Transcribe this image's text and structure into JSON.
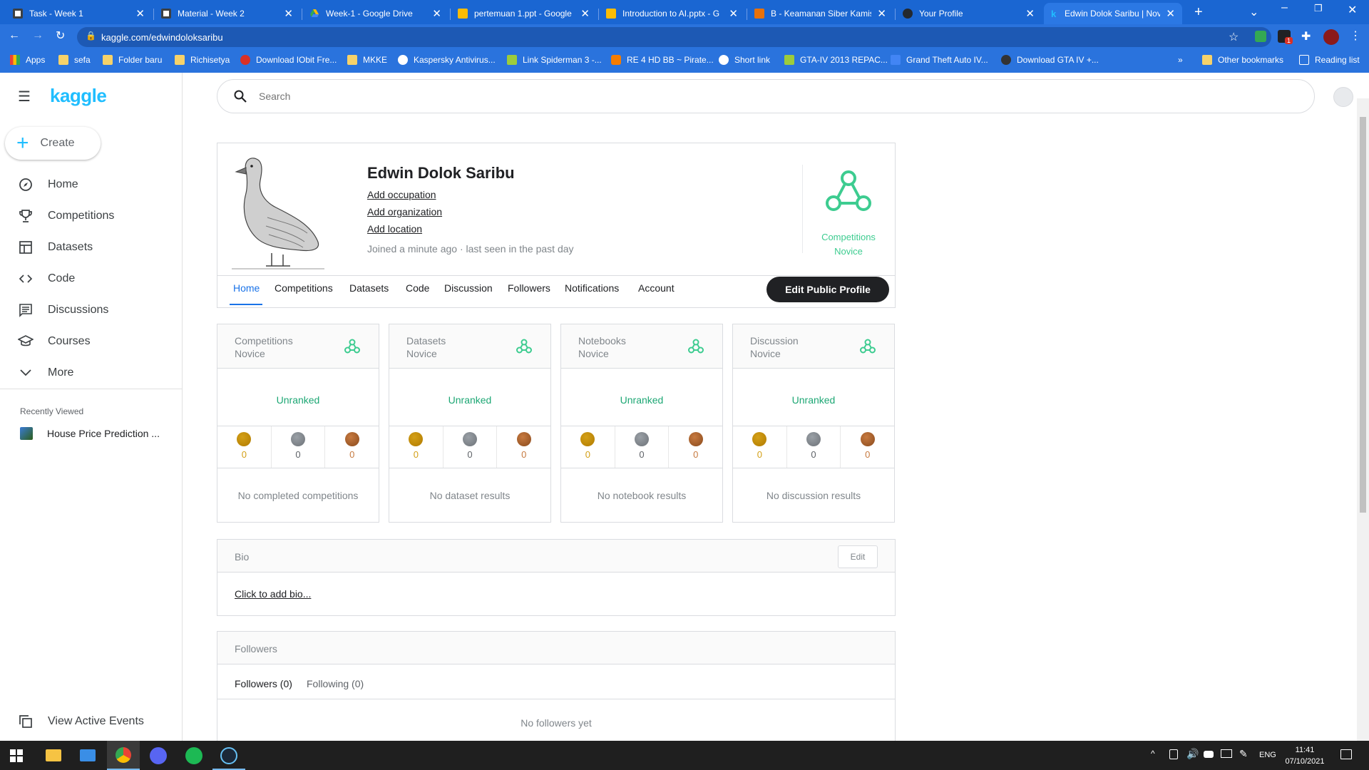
{
  "browser": {
    "tabs": [
      {
        "title": "Task - Week 1",
        "active": false
      },
      {
        "title": "Material - Week 2",
        "active": false
      },
      {
        "title": "Week-1 - Google Drive",
        "active": false
      },
      {
        "title": "pertemuan 1.ppt - Google",
        "active": false
      },
      {
        "title": "Introduction to AI.pptx - G",
        "active": false
      },
      {
        "title": "B - Keamanan Siber Kamis",
        "active": false
      },
      {
        "title": "Your Profile",
        "active": false
      },
      {
        "title": "Edwin Dolok Saribu | Novi",
        "active": true
      }
    ],
    "url": "kaggle.com/edwindoloksaribu",
    "bookmarks": [
      "Apps",
      "sefa",
      "Folder baru",
      "Richisetya",
      "Download IObit Fre...",
      "MKKE",
      "Kaspersky Antivirus...",
      "Link Spiderman 3 -...",
      "RE 4 HD BB ~ Pirate...",
      "Short link",
      "GTA-IV 2013 REPAC...",
      "Grand Theft Auto IV...",
      "Download GTA IV +..."
    ],
    "overflow": "»",
    "other_bookmarks": "Other bookmarks",
    "reading_list": "Reading list",
    "notification_count": "1"
  },
  "sidebar": {
    "logo": "kaggle",
    "create_label": "Create",
    "items": [
      {
        "label": "Home",
        "icon": "compass-icon"
      },
      {
        "label": "Competitions",
        "icon": "trophy-icon"
      },
      {
        "label": "Datasets",
        "icon": "table-icon"
      },
      {
        "label": "Code",
        "icon": "code-icon"
      },
      {
        "label": "Discussions",
        "icon": "discussion-icon"
      },
      {
        "label": "Courses",
        "icon": "school-icon"
      },
      {
        "label": "More",
        "icon": "chevron-down-icon"
      }
    ],
    "recently_viewed_heading": "Recently Viewed",
    "recent_items": [
      "House Price Prediction ..."
    ],
    "view_active_events": "View Active Events"
  },
  "search": {
    "placeholder": "Search"
  },
  "profile": {
    "name": "Edwin Dolok Saribu",
    "add_occupation": "Add occupation",
    "add_organization": "Add organization",
    "add_location": "Add location",
    "joined": "Joined a minute ago · last seen in the past day",
    "tier_line1": "Competitions",
    "tier_line2": "Novice",
    "tabs": [
      "Home",
      "Competitions",
      "Datasets",
      "Code",
      "Discussion",
      "Followers",
      "Notifications",
      "Account"
    ],
    "active_tab": "Home",
    "edit_button": "Edit Public Profile"
  },
  "stats": [
    {
      "title": "Competitions\nNovice",
      "rank": "Unranked",
      "gold": "0",
      "silver": "0",
      "bronze": "0",
      "empty": "No completed competitions"
    },
    {
      "title": "Datasets\nNovice",
      "rank": "Unranked",
      "gold": "0",
      "silver": "0",
      "bronze": "0",
      "empty": "No dataset results"
    },
    {
      "title": "Notebooks\nNovice",
      "rank": "Unranked",
      "gold": "0",
      "silver": "0",
      "bronze": "0",
      "empty": "No notebook results"
    },
    {
      "title": "Discussion\nNovice",
      "rank": "Unranked",
      "gold": "0",
      "silver": "0",
      "bronze": "0",
      "empty": "No discussion results"
    }
  ],
  "bio": {
    "heading": "Bio",
    "edit": "Edit",
    "placeholder": "Click to add bio..."
  },
  "followers": {
    "heading": "Followers",
    "followers_tab": "Followers (0)",
    "following_tab": "Following (0)",
    "empty": "No followers yet"
  },
  "taskbar": {
    "language": "ENG",
    "time": "11:41",
    "date": "07/10/2021"
  },
  "colors": {
    "kaggle_blue": "#20beff",
    "tier_green": "#3dcc90",
    "gold": "#d4a017",
    "silver": "#9aa0a6",
    "bronze": "#c77a40"
  }
}
